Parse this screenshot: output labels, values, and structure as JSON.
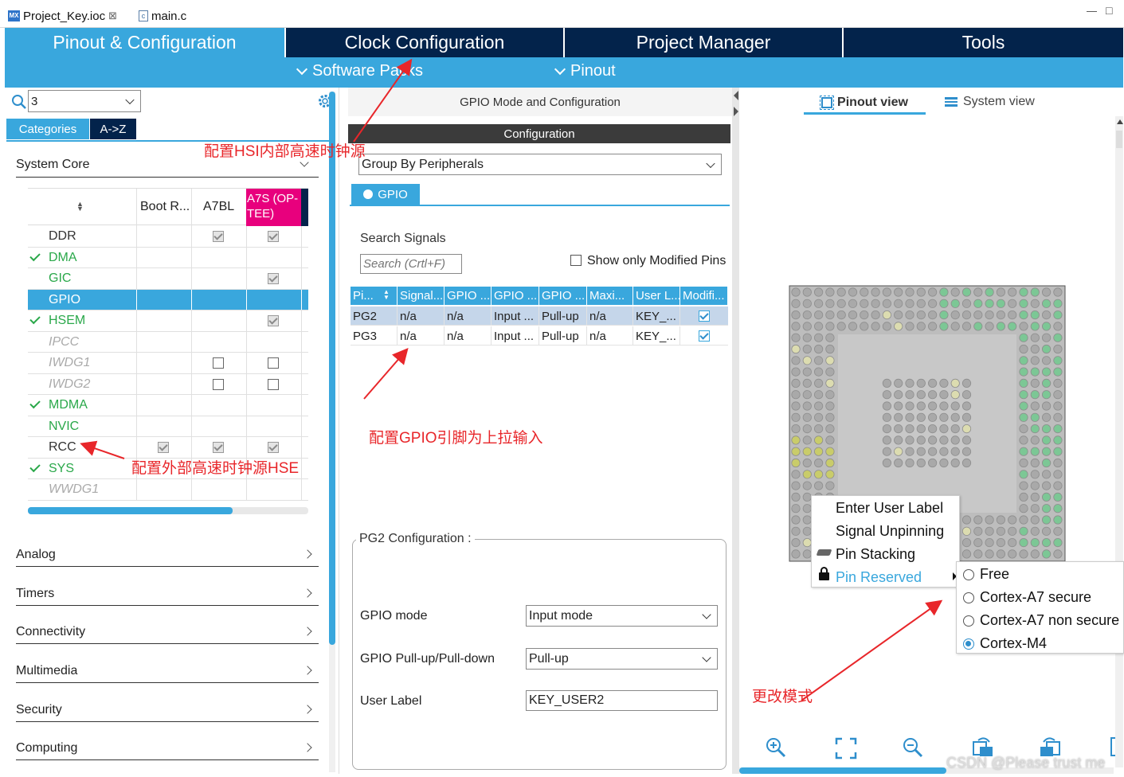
{
  "file_tabs": [
    {
      "label": "Project_Key.ioc",
      "close": "⊠"
    },
    {
      "label": "main.c"
    }
  ],
  "window_controls": {
    "minimize": "—",
    "maximize": "□"
  },
  "top_nav": [
    "Pinout & Configuration",
    "Clock Configuration",
    "Project Manager",
    "Tools"
  ],
  "sub_nav": {
    "software_packs": "Software Packs",
    "pinout": "Pinout"
  },
  "left": {
    "search_value": "3",
    "tabs": {
      "categories": "Categories",
      "az": "A->Z"
    },
    "system_core": "System Core",
    "columns": [
      "Boot R...",
      "A7BL",
      "A7S (OP-TEE)"
    ],
    "rows": [
      {
        "name": "DDR",
        "tick": false,
        "italic": false,
        "sel": false,
        "c": [
          0,
          2,
          2
        ]
      },
      {
        "name": "DMA",
        "tick": true,
        "italic": false,
        "sel": false,
        "c": [
          0,
          0,
          0
        ]
      },
      {
        "name": "GIC",
        "tick": false,
        "italic": false,
        "sel": false,
        "c": [
          0,
          0,
          2
        ]
      },
      {
        "name": "GPIO",
        "tick": false,
        "italic": false,
        "sel": true,
        "c": [
          0,
          0,
          0
        ]
      },
      {
        "name": "HSEM",
        "tick": true,
        "italic": false,
        "sel": false,
        "c": [
          0,
          0,
          2
        ]
      },
      {
        "name": "IPCC",
        "tick": false,
        "italic": true,
        "sel": false,
        "c": [
          0,
          0,
          0
        ]
      },
      {
        "name": "IWDG1",
        "tick": false,
        "italic": true,
        "sel": false,
        "c": [
          0,
          1,
          1
        ]
      },
      {
        "name": "IWDG2",
        "tick": false,
        "italic": true,
        "sel": false,
        "c": [
          0,
          1,
          1
        ]
      },
      {
        "name": "MDMA",
        "tick": true,
        "italic": false,
        "sel": false,
        "c": [
          0,
          0,
          0
        ]
      },
      {
        "name": "NVIC",
        "tick": false,
        "italic": false,
        "sel": false,
        "c": [
          0,
          0,
          0
        ]
      },
      {
        "name": "RCC",
        "tick": false,
        "italic": false,
        "sel": false,
        "c": [
          2,
          2,
          2
        ]
      },
      {
        "name": "SYS",
        "tick": true,
        "italic": false,
        "sel": false,
        "c": [
          0,
          0,
          0
        ]
      },
      {
        "name": "WWDG1",
        "tick": false,
        "italic": true,
        "sel": false,
        "c": [
          0,
          0,
          0
        ]
      }
    ],
    "sections": [
      "Analog",
      "Timers",
      "Connectivity",
      "Multimedia",
      "Security",
      "Computing"
    ]
  },
  "middle": {
    "title": "GPIO Mode and Configuration",
    "config_header": "Configuration",
    "group_by": "Group By Peripherals",
    "gpio_tab": "GPIO",
    "search_label": "Search Signals",
    "search_placeholder": "Search (Crtl+F)",
    "show_modified": "Show only Modified Pins",
    "table_headers": [
      "Pi...",
      "Signal...",
      "GPIO ...",
      "GPIO ...",
      "GPIO ...",
      "Maxi...",
      "User L...",
      "Modifi..."
    ],
    "table_rows": [
      [
        "PG2",
        "n/a",
        "n/a",
        "Input ...",
        "Pull-up",
        "n/a",
        "KEY_..."
      ],
      [
        "PG3",
        "n/a",
        "n/a",
        "Input ...",
        "Pull-up",
        "n/a",
        "KEY_..."
      ]
    ],
    "pg2_title": "PG2 Configuration :",
    "gpio_mode_label": "GPIO mode",
    "gpio_mode_value": "Input mode",
    "pull_label": "GPIO Pull-up/Pull-down",
    "pull_value": "Pull-up",
    "user_label": "User Label",
    "user_label_value": "KEY_USER2"
  },
  "right": {
    "pinout_view": "Pinout view",
    "system_view": "System view",
    "context_menu": [
      "Enter User Label",
      "Signal Unpinning",
      "Pin Stacking",
      "Pin Reserved"
    ],
    "submenu": [
      {
        "label": "Free",
        "selected": false
      },
      {
        "label": "Cortex-A7 secure",
        "selected": false
      },
      {
        "label": "Cortex-A7 non secure",
        "selected": false
      },
      {
        "label": "Cortex-M4",
        "selected": true
      }
    ]
  },
  "annotations": {
    "hsi": "配置HSI内部高速时钟源",
    "hse": "配置外部高速时钟源HSE",
    "gpio": "配置GPIO引脚为上拉输入",
    "mode": "更改模式"
  },
  "watermark": "CSDN @Please trust me",
  "colors": {
    "accent": "#39a7dd",
    "nav_dark": "#03234b",
    "magenta": "#e8007d",
    "annotation": "#e8262a"
  }
}
